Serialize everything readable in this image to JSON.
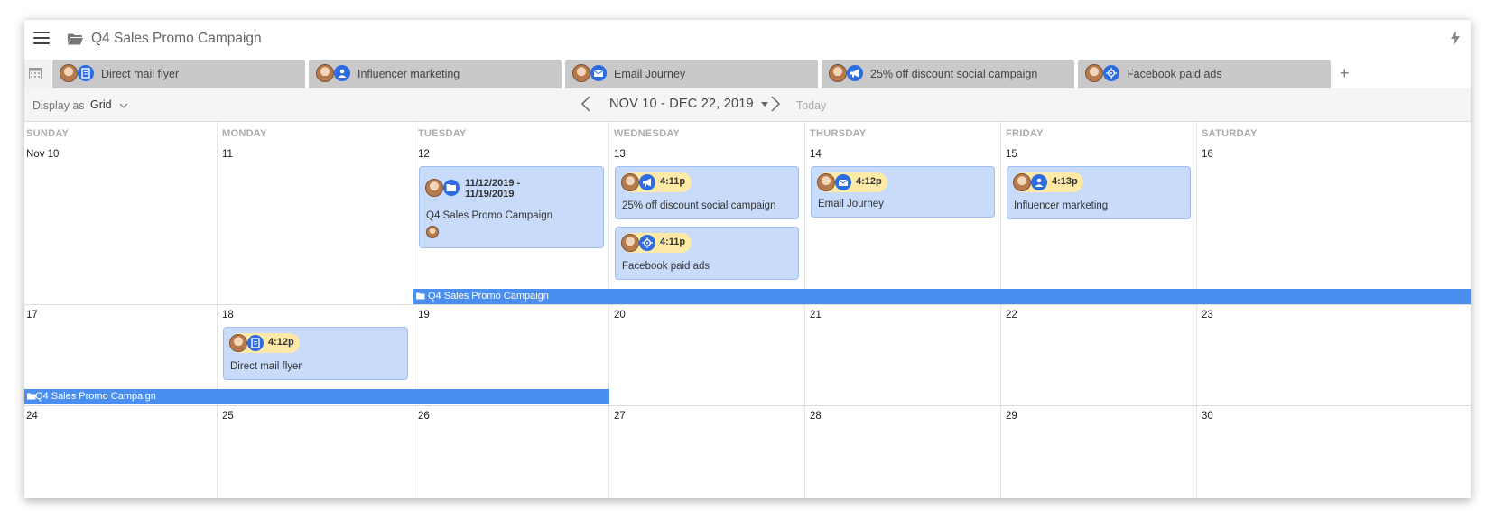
{
  "header": {
    "title": "Q4 Sales Promo Campaign"
  },
  "tabs": [
    {
      "label": "Direct mail flyer",
      "icon": "document-icon"
    },
    {
      "label": "Influencer marketing",
      "icon": "people-icon"
    },
    {
      "label": "Email Journey",
      "icon": "envelope-icon"
    },
    {
      "label": "25% off discount social campaign",
      "icon": "megaphone-icon"
    },
    {
      "label": "Facebook paid ads",
      "icon": "target-icon"
    }
  ],
  "add_tab": "+",
  "toolbar": {
    "display_as": "Display as",
    "view": "Grid",
    "range": "NOV 10 - DEC 22, 2019",
    "today": "Today"
  },
  "days": [
    "SUNDAY",
    "MONDAY",
    "TUESDAY",
    "WEDNESDAY",
    "THURSDAY",
    "FRIDAY",
    "SATURDAY"
  ],
  "weeks": [
    [
      "Nov 10",
      "11",
      "12",
      "13",
      "14",
      "15",
      "16"
    ],
    [
      "17",
      "18",
      "19",
      "20",
      "21",
      "22",
      "23"
    ],
    [
      "24",
      "25",
      "26",
      "27",
      "28",
      "29",
      "30"
    ]
  ],
  "events": {
    "campaign": {
      "dates": [
        "11/12/2019 -",
        "11/19/2019"
      ],
      "title": "Q4 Sales Promo Campaign"
    },
    "social": {
      "time": "4:11p",
      "title": "25% off discount social campaign"
    },
    "facebook": {
      "time": "4:11p",
      "title": "Facebook paid ads"
    },
    "email": {
      "time": "4:12p",
      "title": "Email Journey"
    },
    "influencer": {
      "time": "4:13p",
      "title": "Influencer marketing"
    },
    "mail": {
      "time": "4:12p",
      "title": "Direct mail flyer"
    }
  },
  "span_bar": {
    "label": "Q4 Sales Promo Campaign"
  },
  "colors": {
    "event_bg": "#c8dbfb",
    "span_bar": "#4a8ff0",
    "time_pill": "#ffe9a6",
    "icon_blue": "#2c6be0"
  }
}
